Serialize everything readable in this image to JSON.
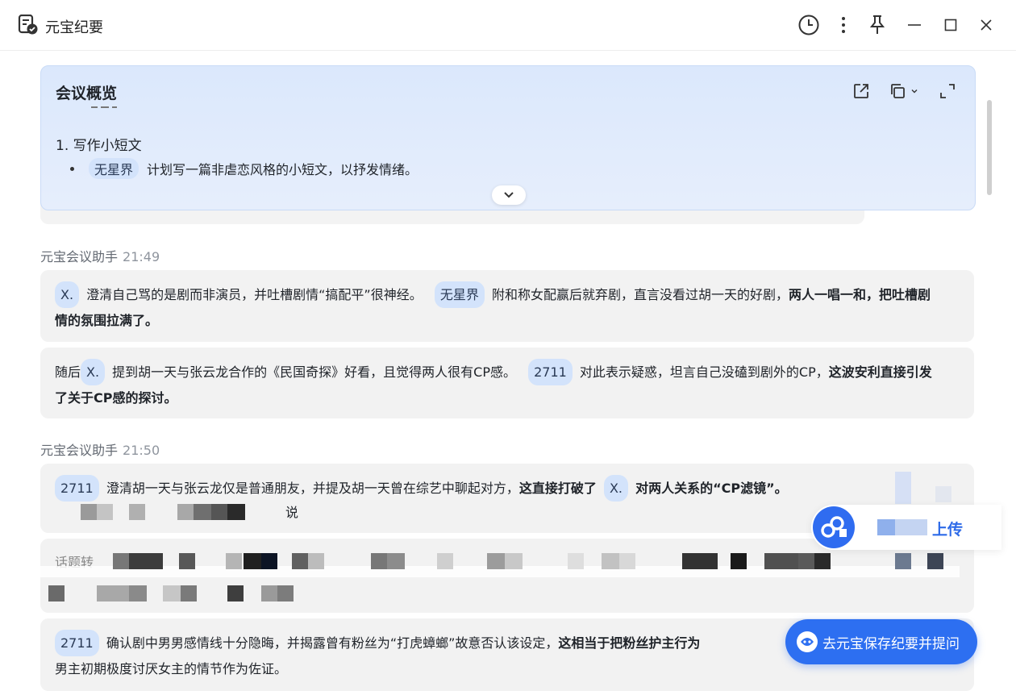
{
  "app": {
    "title": "元宝纪要"
  },
  "overview": {
    "title": "会议概览",
    "section_heading": "1. 写作小短文",
    "bullet_speaker": "无星界",
    "bullet_text": "计划写一篇非虐恋风格的小短文，以抒发情绪。"
  },
  "messages": [
    {
      "sender": "元宝会议助手",
      "time": "21:49",
      "bubbles": [
        {
          "s1": "X.",
          "t1": "澄清自己骂的是剧而非演员，并吐槽剧情“搞配平”很神经。",
          "s2": "无星界",
          "t2": "附和称女配赢后就弃剧，直言没看过胡一天的好剧，",
          "b1": "两人一唱一和，把吐槽剧情的氛围拉满了。"
        },
        {
          "t0": "随后",
          "s1": "X.",
          "t1": "提到胡一天与张云龙合作的《民国奇探》好看，且觉得两人很有CP感。",
          "s2": "2711",
          "t2": "对此表示疑惑，坦言自己没磕到剧外的CP，",
          "b1": "这波安利直接引发了关于CP感的探讨。"
        }
      ]
    },
    {
      "sender": "元宝会议助手",
      "time": "21:50",
      "bubbles": [
        {
          "s1": "2711",
          "t1": "澄清胡一天与张云龙仅是普通朋友，并提及胡一天曾在综艺中聊起对方，",
          "b1": "这直接打破了",
          "s2": "X.",
          "b2": "对两人关系的“CP滤镜”。",
          "tail": "说"
        },
        {
          "lead": "话题转"
        },
        {
          "s1": "2711",
          "t1": "确认剧中男男感情线十分隐晦，并揭露曾有粉丝为“打虎蟑螂”故意否认该设定，",
          "b1": "这相当于把粉丝护主行为",
          "t2": "男主初期极度讨厌女主的情节作为佐证。"
        }
      ]
    }
  ],
  "upload": {
    "label": "上传"
  },
  "save_button": {
    "label": "去元宝保存纪要并提问"
  }
}
